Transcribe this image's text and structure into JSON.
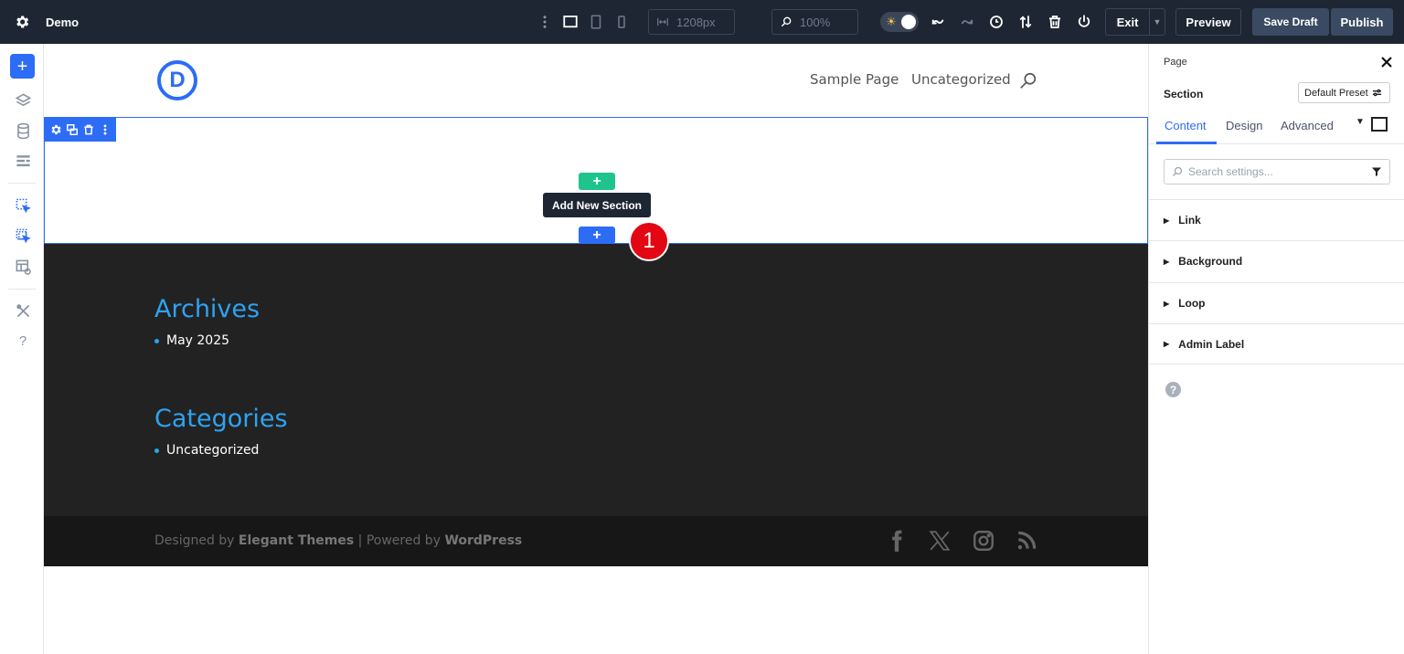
{
  "app": {
    "page_title": "Demo"
  },
  "toolbar": {
    "width_value": "1208px",
    "zoom_value": "100%",
    "exit_label": "Exit",
    "preview_label": "Preview",
    "save_draft_label": "Save Draft",
    "publish_label": "Publish"
  },
  "site": {
    "logo_letter": "D",
    "nav": [
      "Sample Page",
      "Uncategorized"
    ]
  },
  "section": {
    "tooltip": "Add New Section",
    "step_number": "1",
    "add_symbol": "+"
  },
  "footer": {
    "widgets": [
      {
        "title": "Archives",
        "items": [
          "May 2025"
        ]
      },
      {
        "title": "Categories",
        "items": [
          "Uncategorized"
        ]
      }
    ],
    "credits": {
      "prefix": "Designed by ",
      "brand": "Elegant Themes",
      "middle": " | Powered by ",
      "platform": "WordPress"
    },
    "social": [
      "facebook-icon",
      "x-icon",
      "instagram-icon",
      "rss-icon"
    ]
  },
  "panel": {
    "breadcrumb": "Page",
    "title": "Section",
    "preset": "Default Preset",
    "tabs": [
      "Content",
      "Design",
      "Advanced"
    ],
    "search_placeholder": "Search settings...",
    "groups": [
      "Link",
      "Background",
      "Loop",
      "Admin Label"
    ],
    "help": "?"
  },
  "colors": {
    "accent": "#2d6cf5",
    "green": "#1ec48b",
    "topbar": "#1e2633",
    "badge": "#e30613",
    "widget_title": "#2ea3f2"
  }
}
